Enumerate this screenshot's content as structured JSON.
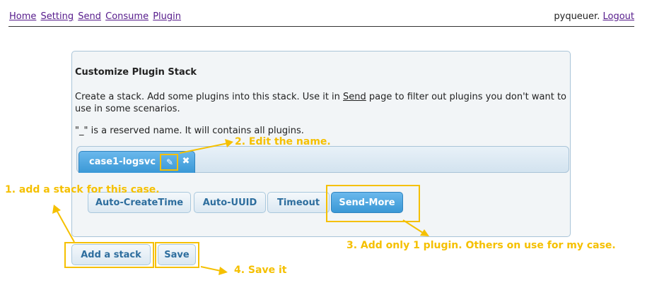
{
  "nav": {
    "links": [
      "Home",
      "Setting",
      "Send",
      "Consume",
      "Plugin"
    ],
    "user": "pyqueuer.",
    "logout": "Logout"
  },
  "panel": {
    "title": "Customize Plugin Stack",
    "desc_before": "Create a stack. Add some plugins into this stack. Use it in ",
    "desc_link": "Send",
    "desc_after": " page to filter out plugins you don't want to use in some scenarios.",
    "note": "\"_\" is a reserved name. It will contains all plugins."
  },
  "tabs": [
    {
      "label": "case1-logsvc",
      "edit_icon": "pencil-icon",
      "close_icon": "close-icon"
    }
  ],
  "plugins": [
    {
      "label": "Auto-CreateTime",
      "selected": false
    },
    {
      "label": "Auto-UUID",
      "selected": false
    },
    {
      "label": "Timeout",
      "selected": false
    },
    {
      "label": "Send-More",
      "selected": true
    }
  ],
  "buttons": {
    "add_stack": "Add a stack",
    "save": "Save"
  },
  "annotations": {
    "color": "#f5c000",
    "step1": "1. add a stack for this case.",
    "step2": "2. Edit the name.",
    "step3": "3. Add only 1 plugin. Others on use for my case.",
    "step4": "4. Save it"
  }
}
